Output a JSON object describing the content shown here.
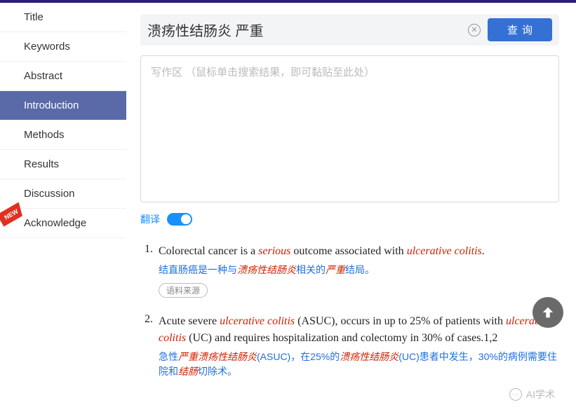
{
  "sidebar": {
    "items": [
      {
        "label": "Title"
      },
      {
        "label": "Keywords"
      },
      {
        "label": "Abstract"
      },
      {
        "label": "Introduction"
      },
      {
        "label": "Methods"
      },
      {
        "label": "Results"
      },
      {
        "label": "Discussion"
      },
      {
        "label": "Acknowledge",
        "badge": "NEW"
      }
    ],
    "active_index": 3
  },
  "search": {
    "value": "溃疡性结肠炎 严重",
    "button_label": "查询"
  },
  "writebox": {
    "placeholder": "写作区 （鼠标单击搜索结果，即可黏贴至此处）"
  },
  "translate": {
    "label": "翻译",
    "enabled": true
  },
  "results": [
    {
      "num": "1.",
      "en_parts": [
        {
          "t": "Colorectal cancer is a "
        },
        {
          "t": "serious",
          "hl": true
        },
        {
          "t": " outcome associated with "
        },
        {
          "t": "ulcerative colitis",
          "hl": true
        },
        {
          "t": "."
        }
      ],
      "zh_parts": [
        {
          "t": "结直肠癌是一种与"
        },
        {
          "t": "溃疡性结肠炎",
          "hl": true
        },
        {
          "t": "相关的"
        },
        {
          "t": "严重",
          "hl": true
        },
        {
          "t": "结局。"
        }
      ],
      "source_label": "语料来源"
    },
    {
      "num": "2.",
      "en_parts": [
        {
          "t": "Acute severe "
        },
        {
          "t": "ulcerative colitis",
          "hl": true
        },
        {
          "t": " (ASUC), occurs in up to 25% of patients with "
        },
        {
          "t": "ulcerative colitis",
          "hl": true
        },
        {
          "t": " (UC) and requires hospitalization and colectomy in 30% of cases.1,2"
        }
      ],
      "zh_parts": [
        {
          "t": "急性"
        },
        {
          "t": "严重溃疡性结肠炎",
          "hl": true
        },
        {
          "t": "(ASUC)，在25%的"
        },
        {
          "t": "溃疡性结肠炎",
          "hl": true
        },
        {
          "t": "(UC)患者中发生，30%的病例需要住院和"
        },
        {
          "t": "结肠",
          "hl": true
        },
        {
          "t": "切除术。"
        }
      ]
    }
  ],
  "watermark": {
    "text": "AI学术"
  }
}
